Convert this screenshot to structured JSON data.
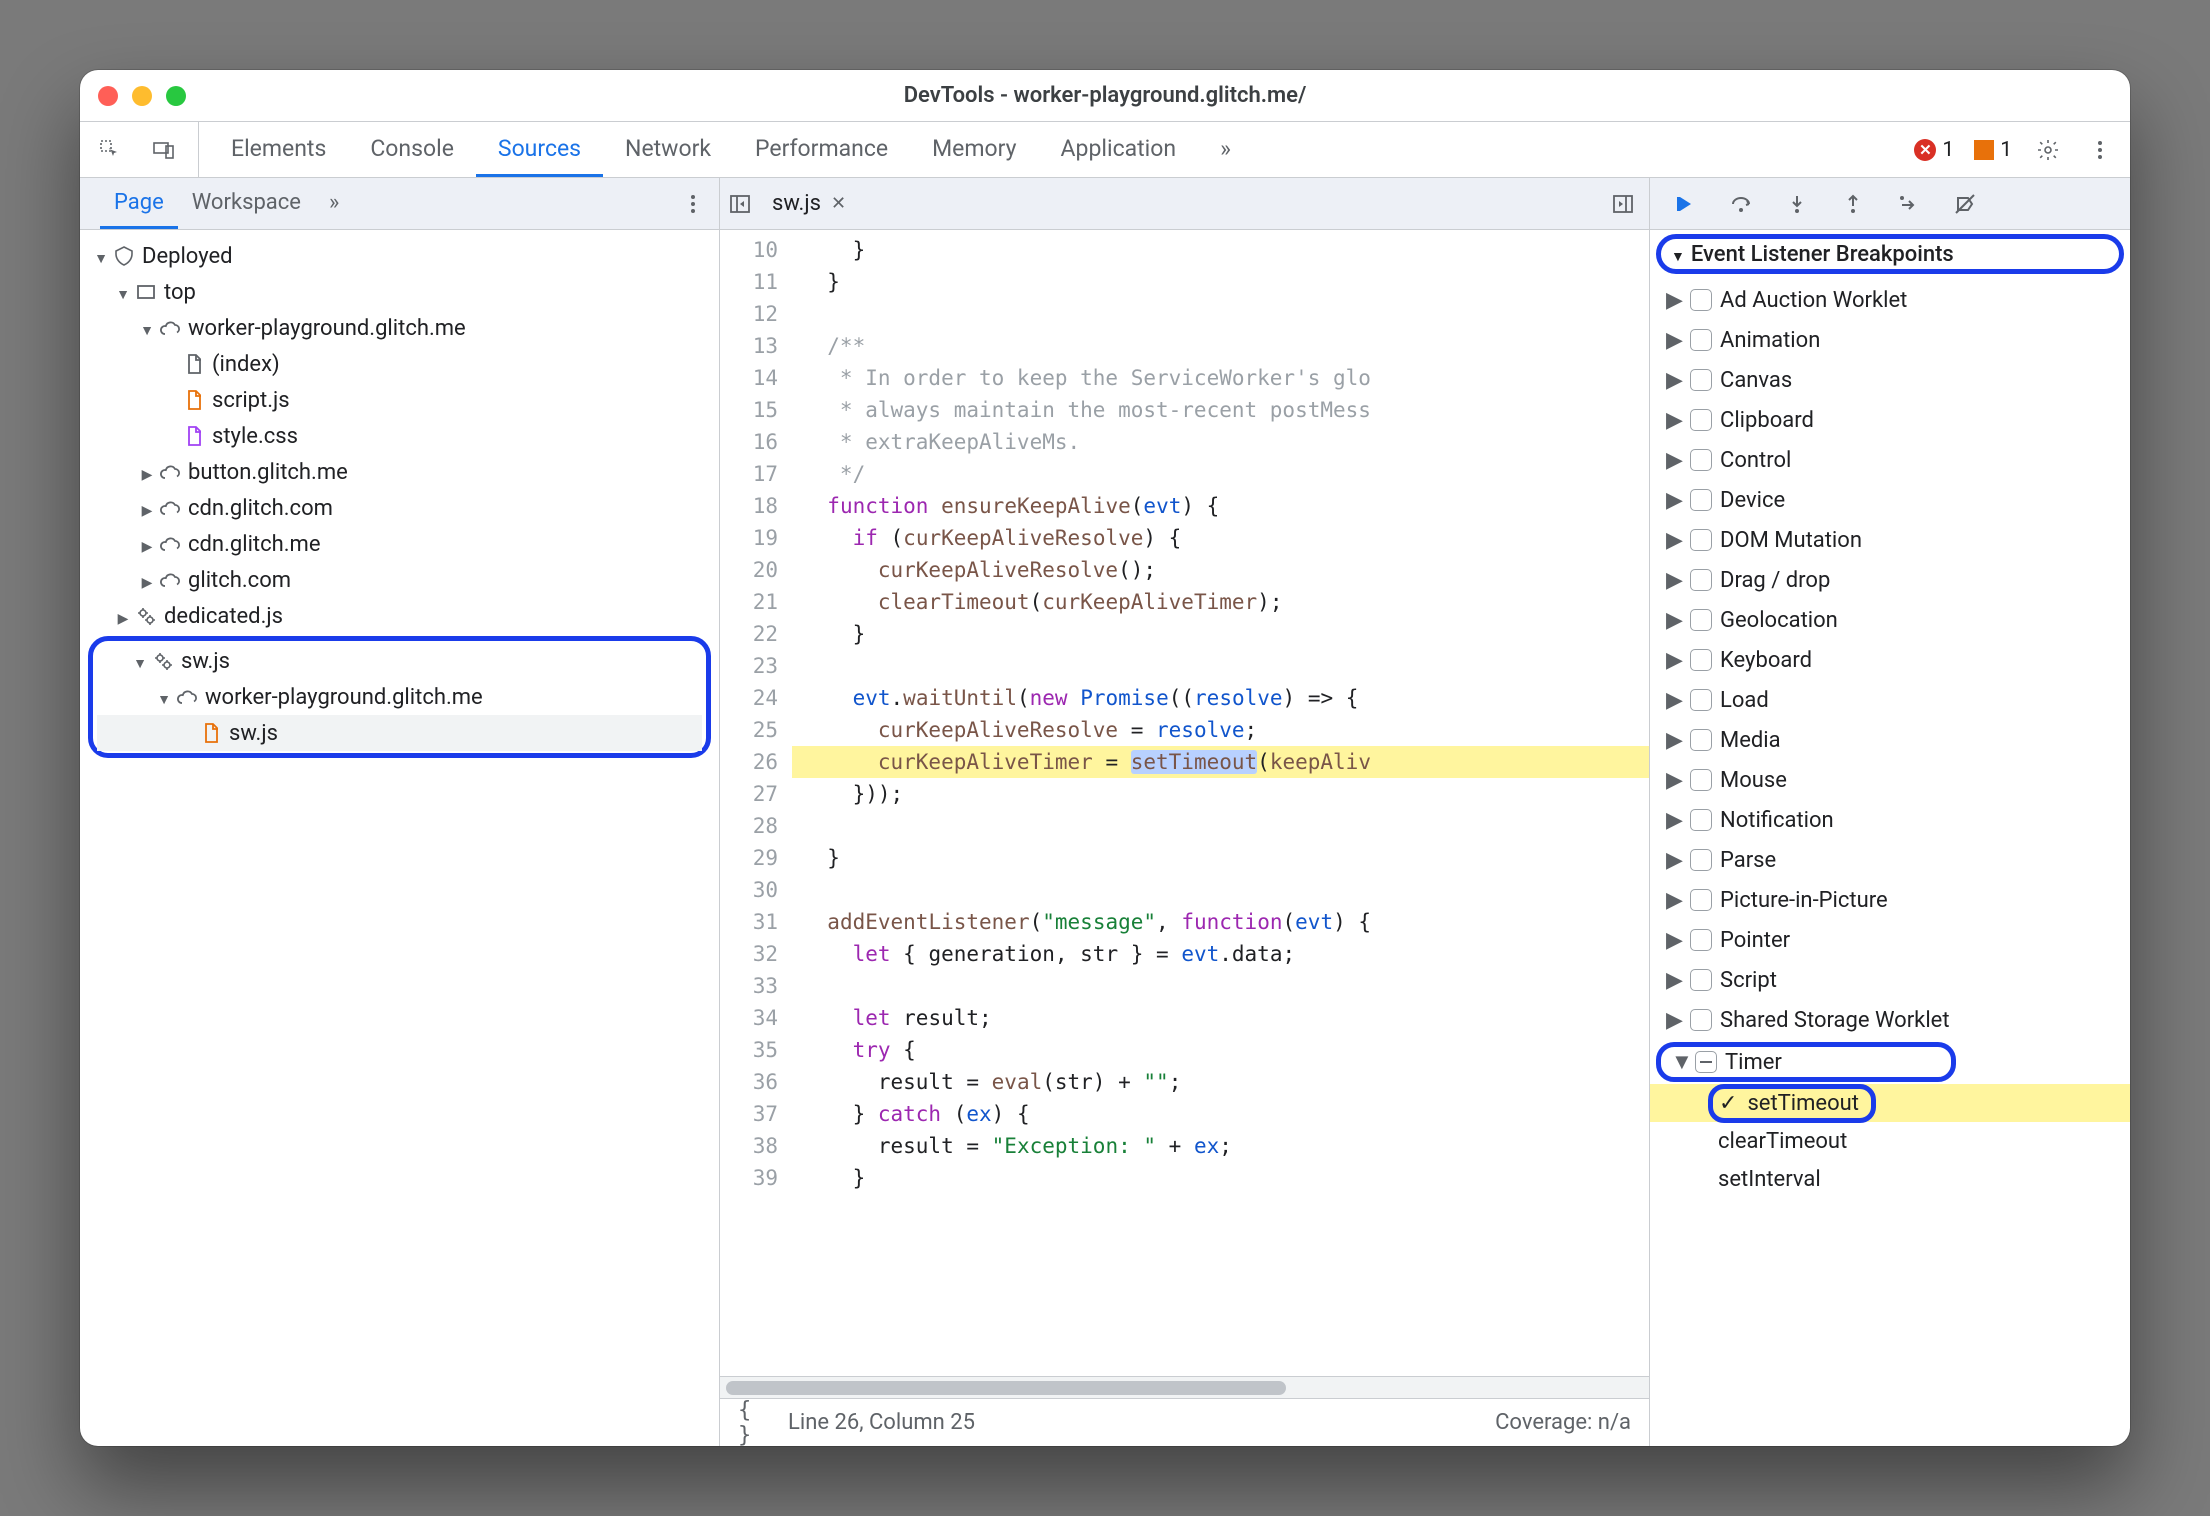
{
  "window": {
    "title": "DevTools - worker-playground.glitch.me/"
  },
  "toolbar_tabs": {
    "items": [
      "Elements",
      "Console",
      "Sources",
      "Network",
      "Performance",
      "Memory",
      "Application"
    ],
    "active_index": 2,
    "more": "»"
  },
  "counters": {
    "errors": "1",
    "warnings": "1"
  },
  "left_panel": {
    "tabs": {
      "items": [
        "Page",
        "Workspace"
      ],
      "active_index": 0,
      "more": "»"
    },
    "tree": [
      {
        "depth": 0,
        "twisty": "down",
        "icon": "deployed",
        "label": "Deployed"
      },
      {
        "depth": 1,
        "twisty": "down",
        "icon": "frame",
        "label": "top"
      },
      {
        "depth": 2,
        "twisty": "down",
        "icon": "cloud",
        "label": "worker-playground.glitch.me"
      },
      {
        "depth": 3,
        "twisty": "none",
        "icon": "file",
        "label": "(index)"
      },
      {
        "depth": 3,
        "twisty": "none",
        "icon": "file-js",
        "label": "script.js"
      },
      {
        "depth": 3,
        "twisty": "none",
        "icon": "file-css",
        "label": "style.css"
      },
      {
        "depth": 2,
        "twisty": "right",
        "icon": "cloud",
        "label": "button.glitch.me"
      },
      {
        "depth": 2,
        "twisty": "right",
        "icon": "cloud",
        "label": "cdn.glitch.com"
      },
      {
        "depth": 2,
        "twisty": "right",
        "icon": "cloud",
        "label": "cdn.glitch.me"
      },
      {
        "depth": 2,
        "twisty": "right",
        "icon": "cloud",
        "label": "glitch.com"
      },
      {
        "depth": 1,
        "twisty": "right",
        "icon": "gears",
        "label": "dedicated.js"
      }
    ],
    "tree_ring": [
      {
        "depth": 1,
        "twisty": "down",
        "icon": "gears",
        "label": "sw.js"
      },
      {
        "depth": 2,
        "twisty": "down",
        "icon": "cloud",
        "label": "worker-playground.glitch.me"
      },
      {
        "depth": 3,
        "twisty": "none",
        "icon": "file-js",
        "label": "sw.js",
        "selected": true
      }
    ]
  },
  "editor": {
    "open_file": "sw.js",
    "first_line": 10,
    "highlight_line": 26,
    "highlight_token": "setTimeout",
    "lines": [
      "    }",
      "  }",
      "",
      "  /**",
      "   * In order to keep the ServiceWorker's glo",
      "   * always maintain the most-recent postMess",
      "   * extraKeepAliveMs.",
      "   */",
      "  function ensureKeepAlive(evt) {",
      "    if (curKeepAliveResolve) {",
      "      curKeepAliveResolve();",
      "      clearTimeout(curKeepAliveTimer);",
      "    }",
      "",
      "    evt.waitUntil(new Promise((resolve) => {",
      "      curKeepAliveResolve = resolve;",
      "      curKeepAliveTimer = setTimeout(keepAliv",
      "    }));",
      "",
      "  }",
      "",
      "  addEventListener(\"message\", function(evt) {",
      "    let { generation, str } = evt.data;",
      "",
      "    let result;",
      "    try {",
      "      result = eval(str) + \"\";",
      "    } catch (ex) {",
      "      result = \"Exception: \" + ex;",
      "    }"
    ],
    "status": {
      "line_col": "Line 26, Column 25",
      "coverage": "Coverage: n/a"
    }
  },
  "debugger": {
    "section_title": "Event Listener Breakpoints",
    "categories": [
      {
        "label": "Ad Auction Worklet",
        "open": false
      },
      {
        "label": "Animation",
        "open": false
      },
      {
        "label": "Canvas",
        "open": false
      },
      {
        "label": "Clipboard",
        "open": false
      },
      {
        "label": "Control",
        "open": false
      },
      {
        "label": "Device",
        "open": false
      },
      {
        "label": "DOM Mutation",
        "open": false
      },
      {
        "label": "Drag / drop",
        "open": false
      },
      {
        "label": "Geolocation",
        "open": false
      },
      {
        "label": "Keyboard",
        "open": false
      },
      {
        "label": "Load",
        "open": false
      },
      {
        "label": "Media",
        "open": false
      },
      {
        "label": "Mouse",
        "open": false
      },
      {
        "label": "Notification",
        "open": false
      },
      {
        "label": "Parse",
        "open": false
      },
      {
        "label": "Picture-in-Picture",
        "open": false
      },
      {
        "label": "Pointer",
        "open": false
      },
      {
        "label": "Script",
        "open": false
      },
      {
        "label": "Shared Storage Worklet",
        "open": false
      }
    ],
    "timer": {
      "label": "Timer",
      "state": "indeterminate",
      "items": [
        {
          "label": "setTimeout",
          "checked": true,
          "highlight": true,
          "ring": true
        },
        {
          "label": "clearTimeout",
          "checked": false
        },
        {
          "label": "setInterval",
          "checked": false
        }
      ]
    }
  }
}
